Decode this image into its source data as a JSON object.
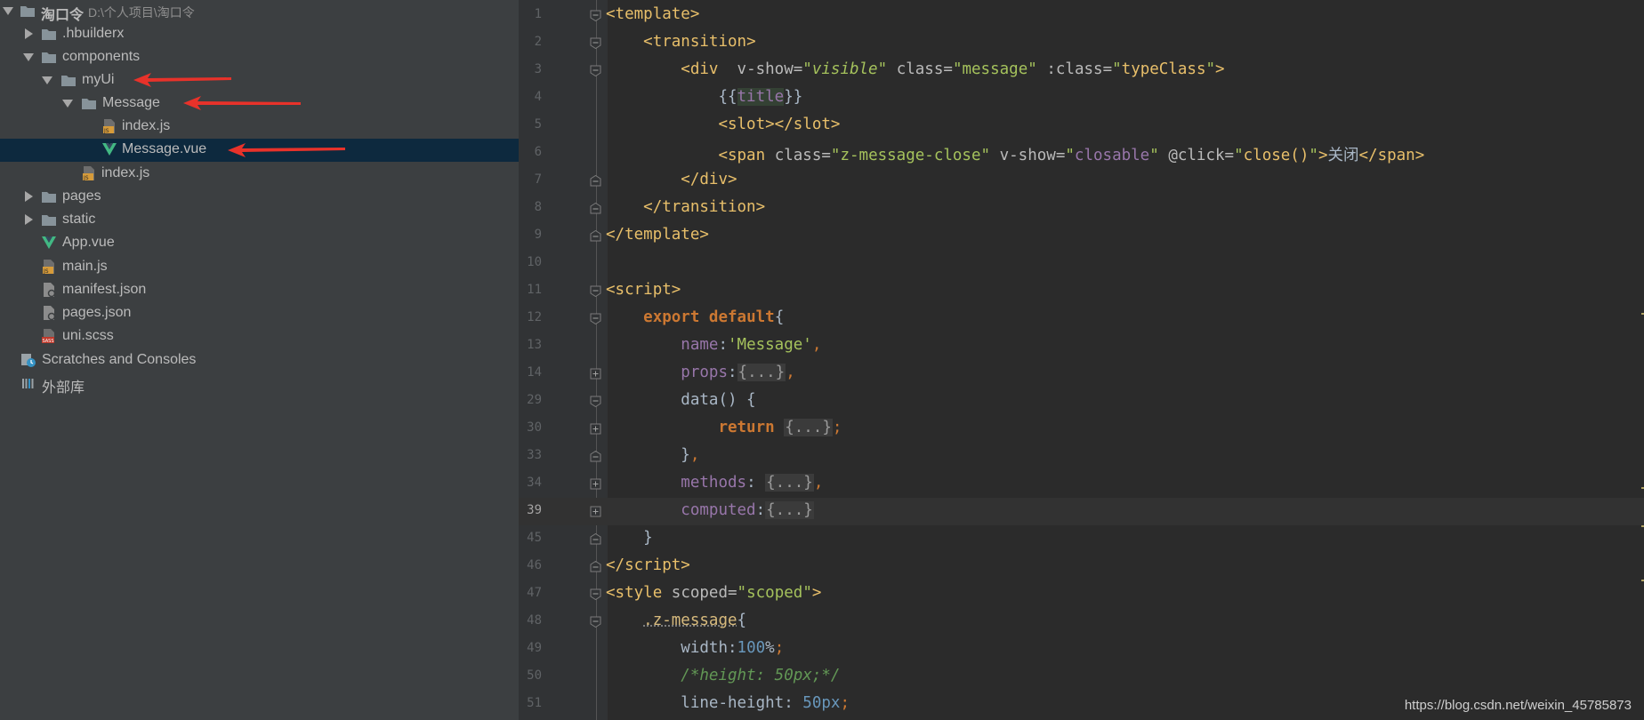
{
  "tree": {
    "root": {
      "label": "淘口令",
      "path": "D:\\个人项目\\淘口令"
    },
    "hbuilderx": ".hbuilderx",
    "components": "components",
    "myui": "myUi",
    "message_folder": "Message",
    "index_js_inner": "index.js",
    "message_vue": "Message.vue",
    "index_js_outer": "index.js",
    "pages": "pages",
    "static": "static",
    "app_vue": "App.vue",
    "main_js": "main.js",
    "manifest_json": "manifest.json",
    "pages_json": "pages.json",
    "uni_scss": "uni.scss",
    "scratches": "Scratches and Consoles",
    "external_libs": "外部库"
  },
  "annotation_color": "#e8322a",
  "editor": {
    "line_numbers": [
      "1",
      "2",
      "3",
      "4",
      "5",
      "6",
      "7",
      "8",
      "9",
      "10",
      "11",
      "12",
      "13",
      "14",
      "29",
      "30",
      "33",
      "34",
      "39",
      "45",
      "46",
      "47",
      "48",
      "49",
      "50",
      "51"
    ],
    "current_line": "39",
    "tokens": {
      "template": "template",
      "transition": "transition",
      "div": "div",
      "v_show": "v-show",
      "visible": "visible",
      "class_attr": "class",
      "message_str": "message",
      "bind_class": ":class",
      "type_class": "typeClass",
      "mustache_open": "{{",
      "title": "title",
      "mustache_close": "}}",
      "slot": "slot",
      "span": "span",
      "close_class_value": "z-message-close",
      "closable": "closable",
      "click_attr": "@click",
      "close_call": "close()",
      "close_text": "关闭",
      "script": "script",
      "export": "export",
      "default": "default",
      "name_key": "name",
      "name_value": "'Message'",
      "props_key": "props",
      "data_key": "data",
      "return_kw": "return",
      "methods_key": "methods",
      "computed_key": "computed",
      "folded": "{...}",
      "style": "style",
      "scoped_attr": "scoped",
      "scoped_value": "scoped",
      "z_message_selector": ".z-message",
      "width_prop": "width",
      "width_value": "100",
      "percent": "%",
      "height_comment": "/*height: 50px;*/",
      "line_height_prop": "line-height",
      "line_height_value": "50",
      "px_unit": "px"
    }
  },
  "watermark": "https://blog.csdn.net/weixin_45785873",
  "icons": {
    "folder": "folder-icon",
    "js_file": "js-file-icon",
    "vue_file": "vue-file-icon",
    "json_file": "json-file-icon",
    "sass_file": "sass-file-icon",
    "scratches": "scratches-icon",
    "library": "library-icon"
  }
}
